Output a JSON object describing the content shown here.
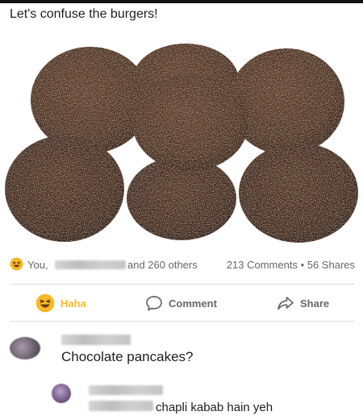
{
  "post": {
    "text": "Let's confuse the burgers!"
  },
  "reactions": {
    "you_label": "You,",
    "others_label": "and 260 others",
    "counts_label": "213 Comments • 56 Shares",
    "reaction_icon": "haha-emoji-icon"
  },
  "actions": {
    "haha_label": "Haha",
    "comment_label": "Comment",
    "share_label": "Share"
  },
  "comments": [
    {
      "text": "Chocolate pancakes?"
    },
    {
      "text": "chapli kabab hain yeh"
    }
  ],
  "colors": {
    "haha_yellow": "#f7b928",
    "meta_gray": "#65676b",
    "divider": "#dadde1",
    "patty_brown": "#4a2f22"
  }
}
